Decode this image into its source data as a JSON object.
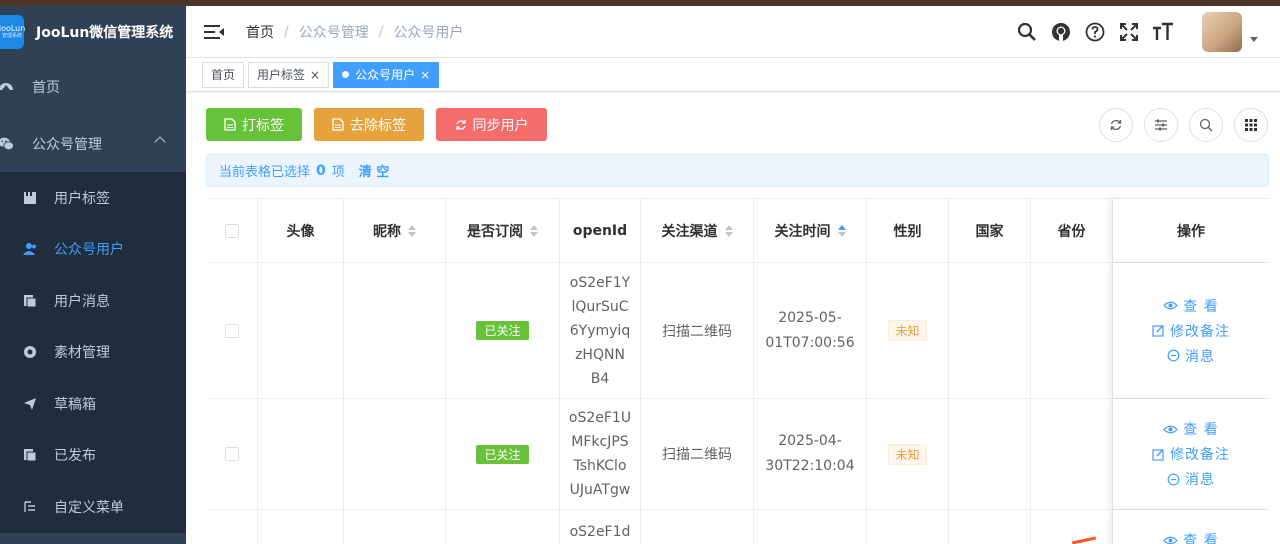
{
  "app": {
    "logo_line1": "JooLun",
    "logo_line2": "管理系统",
    "title": "JooLun微信管理系统"
  },
  "sidebar": {
    "home": "首页",
    "group": "公众号管理",
    "items": [
      {
        "label": "用户标签",
        "icon": "folder-icon"
      },
      {
        "label": "公众号用户",
        "icon": "user-icon"
      },
      {
        "label": "用户消息",
        "icon": "copy-icon"
      },
      {
        "label": "素材管理",
        "icon": "lifebuoy-icon"
      },
      {
        "label": "草稿箱",
        "icon": "send-icon"
      },
      {
        "label": "已发布",
        "icon": "copy-icon"
      },
      {
        "label": "自定义菜单",
        "icon": "menu-icon"
      }
    ]
  },
  "breadcrumb": {
    "c1": "首页",
    "sep": "/",
    "c2": "公众号管理",
    "c3": "公众号用户"
  },
  "tags": {
    "t1": "首页",
    "t2": "用户标签",
    "t3": "公众号用户",
    "close": "×"
  },
  "toolbar": {
    "tag": "打标签",
    "untag": "去除标签",
    "sync": "同步用户"
  },
  "selection": {
    "prefix": "当前表格已选择",
    "count": "0",
    "suffix": "项",
    "clear": "清 空"
  },
  "table": {
    "headers": {
      "avatar": "头像",
      "nickname": "昵称",
      "subscribe": "是否订阅",
      "openid": "openId",
      "channel": "关注渠道",
      "time": "关注时间",
      "gender": "性别",
      "country": "国家",
      "province": "省份",
      "ops": "操作"
    },
    "rows": [
      {
        "status": "已关注",
        "openid": [
          "oS2eF1Y",
          "lQurSuC",
          "6Yymyiq",
          "zHQNN",
          "B4"
        ],
        "channel": "扫描二维码",
        "time": [
          "2025-05-",
          "01T07:00:56"
        ],
        "gender": "未知"
      },
      {
        "status": "已关注",
        "openid": [
          "oS2eF1U",
          "MFkcJPS",
          "TshKClo",
          "UJuATgw"
        ],
        "channel": "扫描二维码",
        "time": [
          "2025-04-",
          "30T22:10:04"
        ],
        "gender": "未知"
      },
      {
        "openid": [
          "oS2eF1d"
        ]
      }
    ],
    "ops": {
      "view": "查 看",
      "remark": "修改备注",
      "msg": "消息"
    }
  },
  "colors": {
    "sidebar": "#304156",
    "primary": "#409eff",
    "success": "#67c23a",
    "warning": "#e6a23c",
    "danger": "#f56c6c"
  }
}
